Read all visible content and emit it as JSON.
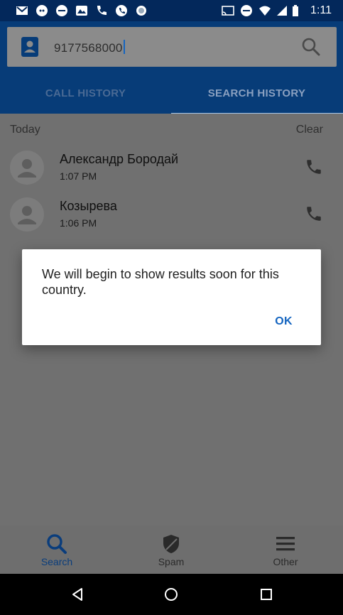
{
  "status_bar": {
    "time": "1:11",
    "icons": [
      "gmail-icon",
      "wechat-icon",
      "messenger-icon",
      "mountain-icon",
      "phone-id-icon",
      "phone-icon",
      "circle-icon",
      "cast-icon",
      "do-not-disturb-icon",
      "wifi-icon",
      "battery-icon"
    ]
  },
  "search": {
    "value": "9177568000",
    "icon_left": "contact-card-icon",
    "icon_right": "search-icon"
  },
  "tabs": [
    {
      "label": "CALL HISTORY",
      "selected": false
    },
    {
      "label": "SEARCH HISTORY",
      "selected": true
    }
  ],
  "history": {
    "section_title": "Today",
    "clear_label": "Clear",
    "items": [
      {
        "name": "Александр Бородай",
        "time": "1:07 PM"
      },
      {
        "name": "Козырева",
        "time": "1:06 PM"
      }
    ]
  },
  "dialog": {
    "message": "We will begin to show results soon for this country.",
    "ok_label": "OK"
  },
  "bottom_nav": [
    {
      "label": "Search",
      "icon": "search-icon",
      "active": true
    },
    {
      "label": "Spam",
      "icon": "shield-icon",
      "active": false
    },
    {
      "label": "Other",
      "icon": "menu-icon",
      "active": false
    }
  ],
  "system_nav": [
    "back-icon",
    "home-icon",
    "recents-icon"
  ],
  "colors": {
    "header": "#073c78",
    "status_bar": "#03285b",
    "accent": "#1565c0",
    "scrim_background": "#707070"
  }
}
